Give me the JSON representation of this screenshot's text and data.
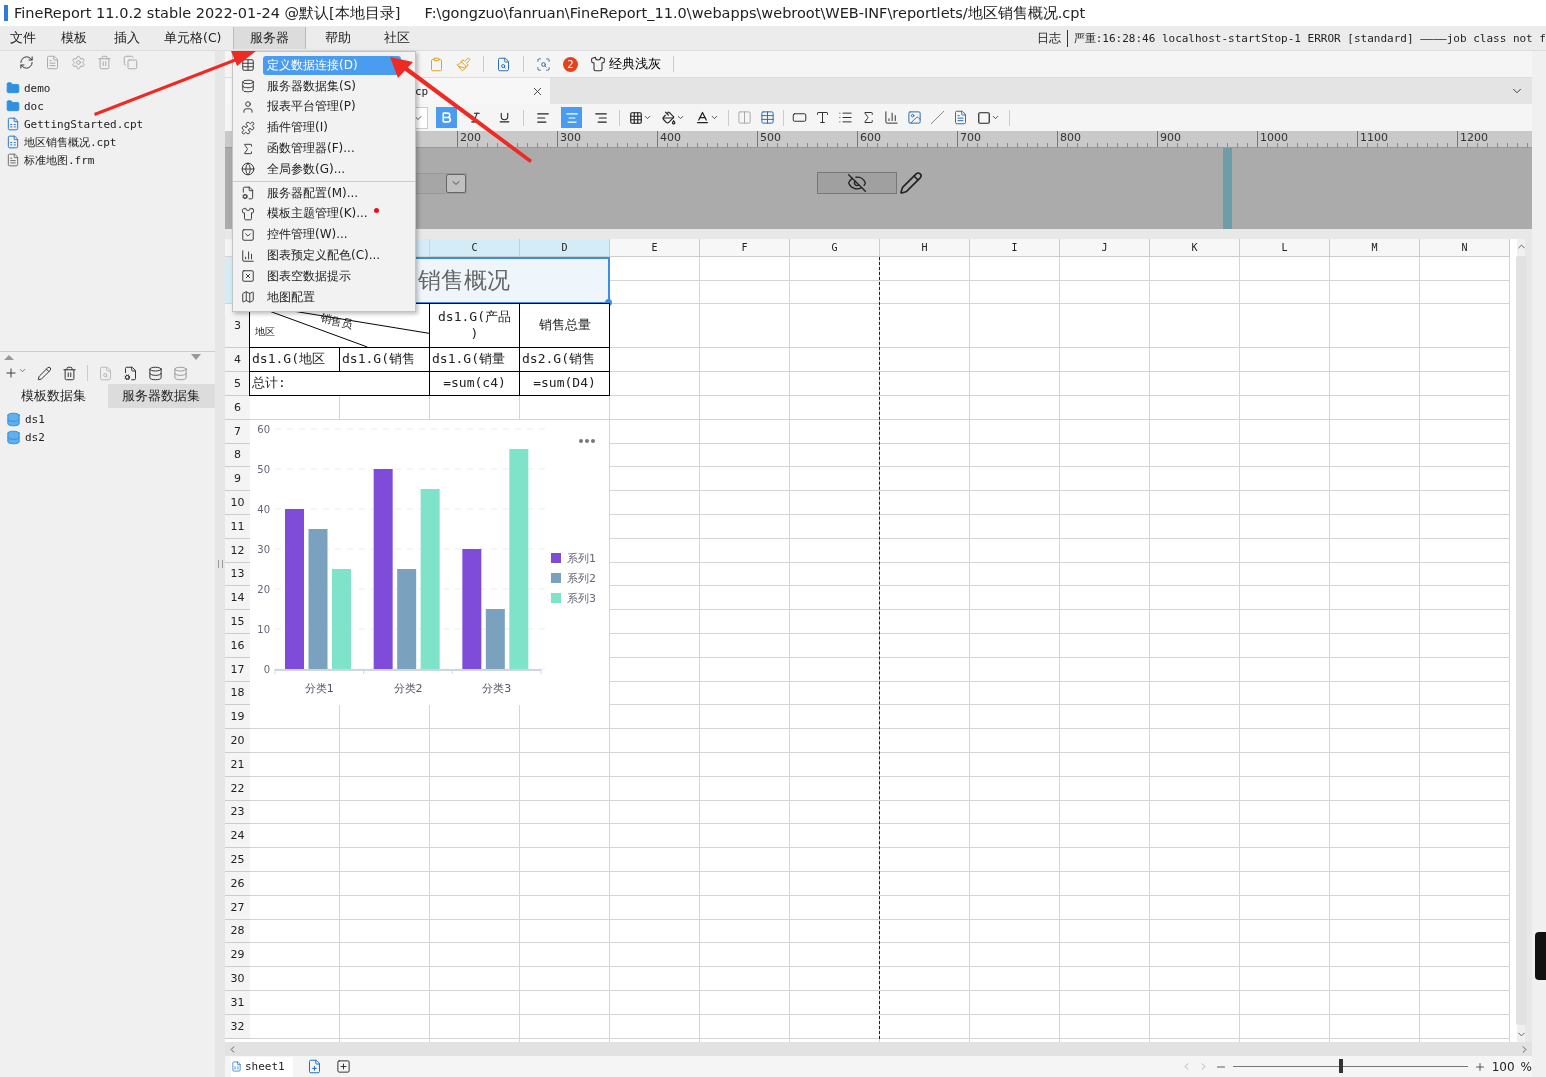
{
  "title_bar": {
    "app": "FineReport 11.0.2 stable 2022-01-24 @默认[本地目录]",
    "path": "F:\\gongzuo\\fanruan\\FineReport_11.0\\webapps\\webroot\\WEB-INF\\reportlets/地区销售概况.cpt"
  },
  "menu_bar": {
    "items": [
      {
        "label": "文件",
        "selected": false
      },
      {
        "label": "模板",
        "selected": false
      },
      {
        "label": "插入",
        "selected": false
      },
      {
        "label": "单元格(C)",
        "selected": false
      },
      {
        "label": "服务器",
        "selected": true
      },
      {
        "label": "帮助",
        "selected": false
      },
      {
        "label": "社区",
        "selected": false
      }
    ],
    "log_label": "日志",
    "log_message": "严重:16:28:46 localhost-startStop-1 ERROR [standard] ————job class not f"
  },
  "server_menu": {
    "groups": [
      [
        {
          "label": "定义数据连接(D)",
          "selected": true,
          "notice": false
        },
        {
          "label": "服务器数据集(S)",
          "selected": false,
          "notice": false
        },
        {
          "label": "报表平台管理(P)",
          "selected": false,
          "notice": false
        },
        {
          "label": "插件管理(I)",
          "selected": false,
          "notice": false
        },
        {
          "label": "函数管理器(F)...",
          "selected": false,
          "notice": false
        },
        {
          "label": "全局参数(G)...",
          "selected": false,
          "notice": false
        }
      ],
      [
        {
          "label": "服务器配置(M)...",
          "selected": false,
          "notice": false
        },
        {
          "label": "模板主题管理(K)...",
          "selected": false,
          "notice": true
        },
        {
          "label": "控件管理(W)...",
          "selected": false,
          "notice": false
        },
        {
          "label": "图表预定义配色(C)...",
          "selected": false,
          "notice": false
        },
        {
          "label": "图表空数据提示",
          "selected": false,
          "notice": false
        },
        {
          "label": "地图配置",
          "selected": false,
          "notice": false
        }
      ]
    ]
  },
  "left_panel": {
    "file_tree": [
      {
        "label": "demo",
        "kind": "folder"
      },
      {
        "label": "doc",
        "kind": "folder"
      },
      {
        "label": "GettingStarted.cpt",
        "kind": "report"
      },
      {
        "label": "地区销售概况.cpt",
        "kind": "report"
      },
      {
        "label": "标准地图.frm",
        "kind": "form"
      }
    ],
    "dataset_tabs": [
      {
        "label": "模板数据集",
        "selected": true
      },
      {
        "label": "服务器数据集",
        "selected": false
      }
    ],
    "datasets": [
      "ds1",
      "ds2"
    ]
  },
  "toolbar": {
    "notification_count": "2",
    "theme": "经典浅灰"
  },
  "document_tab": {
    "label": "cp"
  },
  "format_toolbar": {
    "bold": {
      "selected": true
    },
    "italic": {
      "selected": false
    },
    "underline": {
      "selected": false
    },
    "align": [
      {
        "selected": false
      },
      {
        "selected": true
      },
      {
        "selected": false
      }
    ]
  },
  "ruler": {
    "labels": [
      "200",
      "300",
      "400",
      "500",
      "600",
      "700",
      "800",
      "900",
      "1000",
      "1100",
      "1200"
    ]
  },
  "sheet": {
    "columns": [
      {
        "label": "C",
        "selected": true
      },
      {
        "label": "D",
        "selected": true
      },
      {
        "label": "E",
        "selected": false
      },
      {
        "label": "F",
        "selected": false
      },
      {
        "label": "G",
        "selected": false
      },
      {
        "label": "H",
        "selected": false
      },
      {
        "label": "I",
        "selected": false
      },
      {
        "label": "J",
        "selected": false
      },
      {
        "label": "K",
        "selected": false
      },
      {
        "label": "L",
        "selected": false
      },
      {
        "label": "M",
        "selected": false
      },
      {
        "label": "N",
        "selected": false
      }
    ],
    "row_numbers": [
      "3",
      "4",
      "5",
      "6",
      "7",
      "8",
      "9",
      "10",
      "11",
      "12",
      "13",
      "14",
      "15",
      "16",
      "17",
      "18",
      "19",
      "20",
      "21",
      "22",
      "23",
      "24",
      "25",
      "26",
      "27",
      "28",
      "29",
      "30",
      "31",
      "32"
    ],
    "title": {
      "text": "销售概况",
      "selected": true
    },
    "corner_header": {
      "column_label": "地区",
      "row_label": "销售员"
    },
    "header_cells": [
      "ds1.G(产品\n)",
      "销售总量"
    ],
    "detail_cells": [
      "ds1.G(地区",
      "ds1.G(销售",
      "ds1.G(销量",
      "ds2.G(销售"
    ],
    "total_label": "总计:",
    "total_cells": [
      "=sum(c4)",
      "=sum(D4)"
    ],
    "chart_data": {
      "type": "bar",
      "categories": [
        "分类1",
        "分类2",
        "分类3"
      ],
      "series": [
        {
          "name": "系列1",
          "color": "#7e4cd8",
          "values": [
            40,
            50,
            30
          ]
        },
        {
          "name": "系列2",
          "color": "#7aa2bf",
          "values": [
            35,
            25,
            15
          ]
        },
        {
          "name": "系列3",
          "color": "#7ee3c8",
          "values": [
            25,
            45,
            55
          ]
        }
      ],
      "ylim": [
        0,
        60
      ],
      "yticks": [
        0,
        10,
        20,
        30,
        40,
        50,
        60
      ],
      "grid": true,
      "legend": true
    }
  },
  "bottom_bar": {
    "sheet_tabs": [
      {
        "label": "sheet1",
        "selected": true
      }
    ],
    "zoom": {
      "level": 0.46,
      "value": "100",
      "unit": "%"
    }
  }
}
